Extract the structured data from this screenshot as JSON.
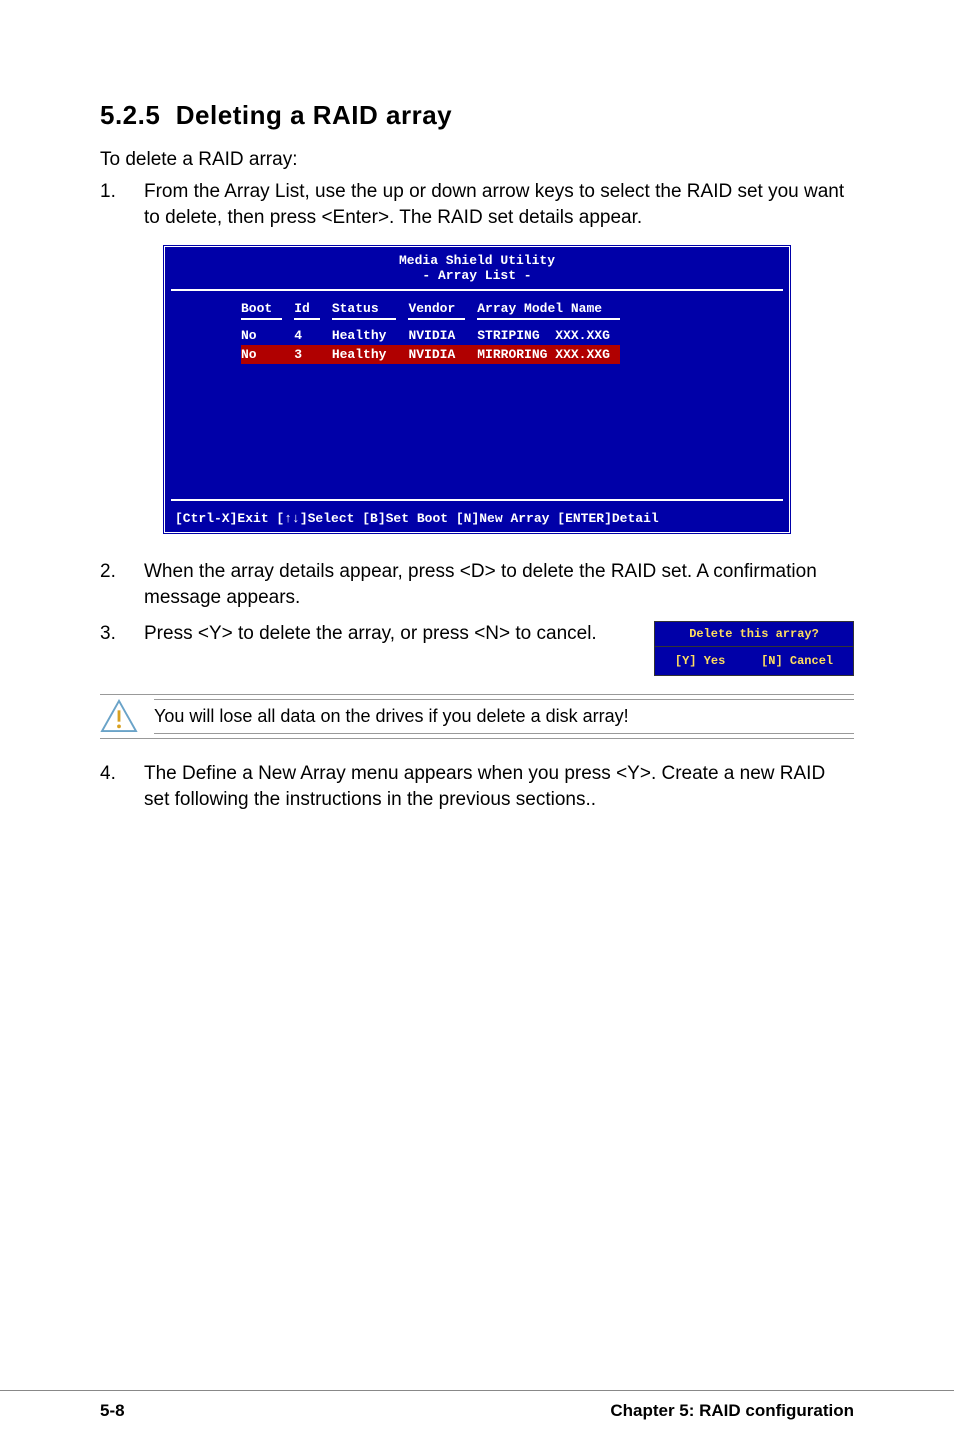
{
  "section": {
    "number": "5.2.5",
    "title": "Deleting a RAID array"
  },
  "lead": "To delete a RAID array:",
  "steps": {
    "s1": {
      "num": "1.",
      "text": "From the Array List, use the up or down arrow keys to select the RAID set you want to delete, then press <Enter>. The RAID set details appear."
    },
    "s2": {
      "num": "2.",
      "text": "When the array details appear, press <D> to delete the RAID set. A confirmation message appears."
    },
    "s3": {
      "num": "3.",
      "text": "Press <Y> to delete the array, or press <N> to cancel."
    },
    "s4": {
      "num": "4.",
      "text": "The Define a New Array menu appears when you press <Y>. Create a new RAID set following the instructions in the previous sections.."
    }
  },
  "bios": {
    "title1": "Media Shield Utility",
    "title2": "- Array List -",
    "headers": {
      "boot": "Boot",
      "id": "Id",
      "status": "Status",
      "vendor": "Vendor",
      "model": "Array Model Name"
    },
    "rows": [
      {
        "boot": "No",
        "id": "4",
        "status": "Healthy",
        "vendor": "NVIDIA",
        "model": "STRIPING  XXX.XXG"
      },
      {
        "boot": "No",
        "id": "3",
        "status": "Healthy",
        "vendor": "NVIDIA",
        "model": "MIRRORING XXX.XXG"
      }
    ],
    "footer": "[Ctrl-X]Exit  [↑↓]Select  [B]Set Boot  [N]New Array  [ENTER]Detail"
  },
  "confirm": {
    "title": "Delete this array?",
    "yes": "[Y] Yes",
    "no": "[N] Cancel"
  },
  "warning": "You will lose all data on the drives if you delete a disk array!",
  "footer": {
    "page": "5-8",
    "chapter": "Chapter 5: RAID configuration"
  }
}
